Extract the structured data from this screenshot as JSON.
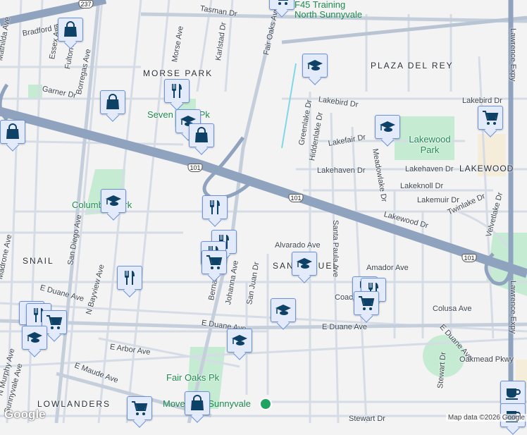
{
  "streets": [
    "Tasman Dr",
    "Bradford Dr",
    "Essex Ave",
    "Fulton Ave",
    "Borregas Ave",
    "Morse Ave",
    "Karlstad Dr",
    "Garner Dr",
    "Fair Oaks Ave",
    "Lakebird Dr",
    "Lakefair Dr",
    "Greenlake Dr",
    "Hiddenlake Dr",
    "Meadowlake Dr",
    "Lakehaven Dr",
    "Lakeknoll Dr",
    "Lakemuir Dr",
    "Lakewood Dr",
    "Twinlake Dr",
    "Velvetlake Dr",
    "Lawrence Expy",
    "Alvarado Ave",
    "Santa Paula Ave",
    "Amador Ave",
    "Coachman Dr",
    "Colusa Ave",
    "E Duane Ave",
    "San Juan Dr",
    "Johanna Ave",
    "Bernal Ave",
    "E Arbor Ave",
    "E Maude Ave",
    "N Bayview Ave",
    "San Diego Ave",
    "Madrone Ave",
    "N Murphy Ave",
    "Sunnyvale Ave",
    "Stewart Dr",
    "Oakmead Pkwy",
    "Mathilda Ave"
  ],
  "neighborhoods": [
    "MORSE PARK",
    "PLAZA DEL REY",
    "LAKEWOOD",
    "SNAIL",
    "SAN MIGUEL",
    "LOWLANDERS"
  ],
  "parks": [
    "Seven Seas Pk",
    "Lakewood Park",
    "Columbia Park",
    "Fair Oaks Pk"
  ],
  "pois": {
    "f45": "F45 Training North Sunnyvale",
    "movement": "Movement Sunnyvale"
  },
  "highways": [
    "237",
    "101",
    "101",
    "101"
  ],
  "markers": [
    "shopping-bag",
    "shopping-bag",
    "restaurant",
    "school",
    "shopping-bag",
    "shopping-bag",
    "school",
    "restaurant",
    "restaurant",
    "restaurant",
    "grocery-cart",
    "restaurant",
    "school",
    "school",
    "school",
    "restaurant",
    "restaurant",
    "grocery-cart",
    "school",
    "grocery-cart",
    "shopping-bag",
    "school",
    "school",
    "grocery-cart",
    "restaurant",
    "restaurant",
    "grocery-cart",
    "cafe",
    "cafe",
    "grocery-cart"
  ],
  "footer": {
    "logo": "Google",
    "attribution": "Map data ©2026 Google"
  },
  "colors": {
    "highway": "#8fa3bf",
    "road": "#d5dce6",
    "park": "#c5ecd3",
    "marker_bg": "#e3ebfb",
    "marker_icon": "#0d4166"
  }
}
